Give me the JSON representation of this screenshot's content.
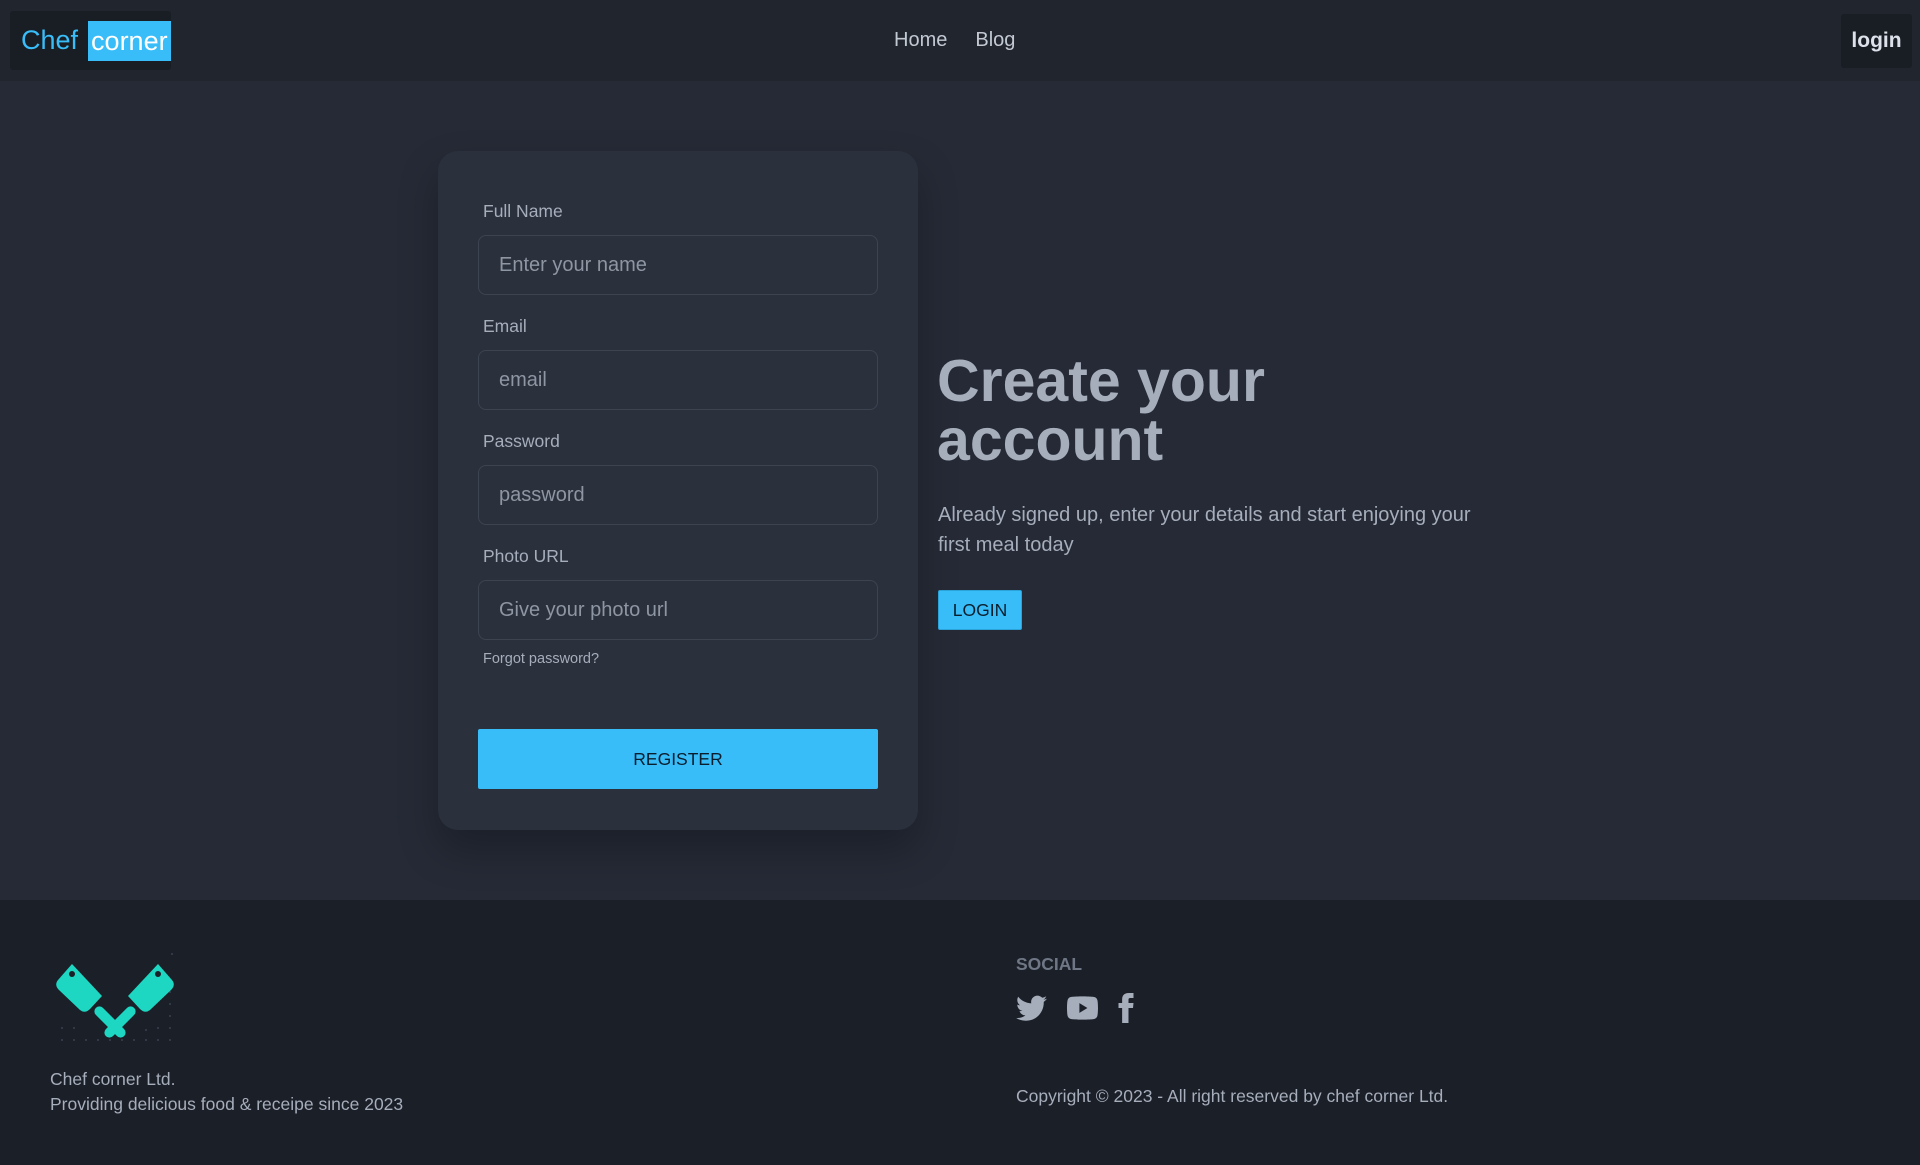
{
  "navbar": {
    "brand_part1": "Chef",
    "brand_part2": "corner",
    "links": [
      "Home",
      "Blog"
    ],
    "login_label": "login"
  },
  "form": {
    "fields": [
      {
        "label": "Full Name",
        "placeholder": "Enter your name"
      },
      {
        "label": "Email",
        "placeholder": "email"
      },
      {
        "label": "Password",
        "placeholder": "password"
      },
      {
        "label": "Photo URL",
        "placeholder": "Give your photo url"
      }
    ],
    "forgot_label": "Forgot password?",
    "register_label": "REGISTER"
  },
  "hero": {
    "title_line1": "Create your",
    "title_line2": "account",
    "desc_line1": "Already signed up, enter your details and start enjoying your",
    "desc_line2": "first meal today",
    "login_button": "LOGIN"
  },
  "footer": {
    "company_name": "Chef corner Ltd.",
    "tagline": "Providing delicious food & receipe since 2023",
    "social_title": "SOCIAL",
    "social_icons": [
      "twitter-icon",
      "youtube-icon",
      "facebook-icon"
    ],
    "copyright": "Copyright © 2023 - All right reserved by chef corner Ltd."
  },
  "colors": {
    "accent": "#38bdf8",
    "background": "#252a36",
    "card": "#2a303c",
    "footer": "#1b1f27",
    "logo": "#1ed7c3"
  }
}
